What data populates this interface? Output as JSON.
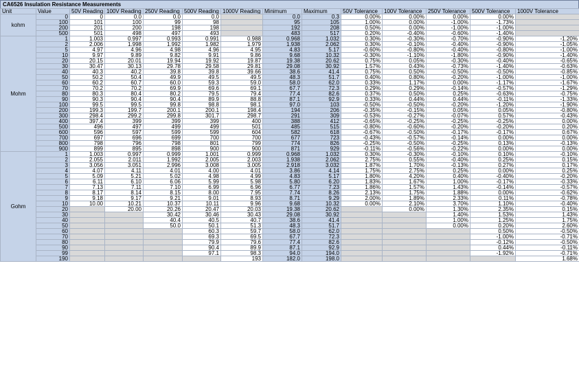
{
  "title": "CA6526 Insulation Resistance Measurements",
  "headers": [
    "Unit",
    "Value",
    "50V Reading",
    "100V Reading",
    "250V Reading",
    "500V Reading",
    "1000V Reading",
    "Minimum",
    "Maximum",
    "50V Tolerance",
    "100V Tolerance",
    "250V Tolerance",
    "500V Tolerance",
    "1000V Tolerance"
  ],
  "groups": [
    {
      "unit": "kohm",
      "rows": [
        [
          "0",
          "0",
          "0.0",
          "0.0",
          "0.0",
          null,
          "0.0",
          "0.3",
          "0.00%",
          "0.00%",
          "0.00%",
          "0.00%",
          null
        ],
        [
          "100",
          "101",
          "100",
          "99",
          "98",
          null,
          "95",
          "105",
          "1.00%",
          "0.00%",
          "-1.00%",
          "-1.73%",
          null
        ],
        [
          "200",
          "201",
          "200",
          "198",
          "198",
          null,
          "192",
          "208",
          "0.50%",
          "0.00%",
          "-1.00%",
          "-1.00%",
          null
        ],
        [
          "500",
          "501",
          "498",
          "497",
          "493",
          null,
          "483",
          "517",
          "0.20%",
          "-0.40%",
          "-0.60%",
          "-1.40%",
          null
        ]
      ]
    },
    {
      "unit": "Mohm",
      "rows": [
        [
          "1",
          "1.003",
          "0.997",
          "0.993",
          "0.991",
          "0.988",
          "0.968",
          "1.032",
          "0.30%",
          "-0.30%",
          "-0.70%",
          "-0.90%",
          "-1.20%"
        ],
        [
          "2",
          "2.006",
          "1.998",
          "1.992",
          "1.982",
          "1.979",
          "1.938",
          "2.062",
          "0.30%",
          "-0.10%",
          "-0.40%",
          "-0.90%",
          "-1.05%"
        ],
        [
          "5",
          "4.97",
          "4.96",
          "4.98",
          "4.96",
          "4.95",
          "4.83",
          "5.17",
          "-0.60%",
          "-0.80%",
          "-0.40%",
          "-0.80%",
          "-1.00%"
        ],
        [
          "10",
          "9.97",
          "9.89",
          "9.82",
          "9.91",
          "9.86",
          "9.68",
          "10.32",
          "-0.30%",
          "-1.10%",
          "-1.80%",
          "-0.90%",
          "-1.40%"
        ],
        [
          "20",
          "20.15",
          "20.01",
          "19.94",
          "19.92",
          "19.87",
          "19.38",
          "20.62",
          "0.75%",
          "0.05%",
          "-0.30%",
          "-0.40%",
          "-0.65%"
        ],
        [
          "30",
          "30.47",
          "30.13",
          "29.78",
          "29.58",
          "29.81",
          "29.08",
          "30.92",
          "1.57%",
          "0.43%",
          "-0.73%",
          "-1.40%",
          "-0.63%"
        ],
        [
          "40",
          "40.3",
          "40.2",
          "39.8",
          "39.8",
          "39.66",
          "38.6",
          "41.4",
          "0.75%",
          "0.50%",
          "-0.50%",
          "-0.50%",
          "-0.85%"
        ],
        [
          "50",
          "50.2",
          "50.4",
          "49.9",
          "49.5",
          "49.5",
          "48.3",
          "51.7",
          "0.40%",
          "0.80%",
          "-0.20%",
          "-1.00%",
          "-1.00%"
        ],
        [
          "60",
          "60.2",
          "60.7",
          "60.0",
          "59.3",
          "59.0",
          "58.0",
          "62.0",
          "0.33%",
          "1.17%",
          "0.00%",
          "-1.17%",
          "-1.67%"
        ],
        [
          "70",
          "70.2",
          "70.2",
          "69.9",
          "69.6",
          "69.1",
          "67.7",
          "72.3",
          "0.29%",
          "0.29%",
          "-0.14%",
          "-0.57%",
          "-1.29%"
        ],
        [
          "80",
          "80.3",
          "80.4",
          "80.2",
          "79.5",
          "79.4",
          "77.4",
          "82.6",
          "0.37%",
          "0.50%",
          "0.25%",
          "-0.63%",
          "-0.75%"
        ],
        [
          "90",
          "90.3",
          "90.4",
          "90.4",
          "89.9",
          "88.8",
          "87.1",
          "92.9",
          "0.33%",
          "0.44%",
          "0.44%",
          "-0.11%",
          "-1.33%"
        ],
        [
          "100",
          "99.5",
          "99.5",
          "99.8",
          "98.8",
          "98.1",
          "97.0",
          "103",
          "-0.50%",
          "-0.50%",
          "-0.20%",
          "-1.20%",
          "-1.90%"
        ],
        [
          "200",
          "199.3",
          "199.7",
          "200.1",
          "200.1",
          "198.4",
          "194",
          "206",
          "-0.35%",
          "-0.15%",
          "0.05%",
          "0.05%",
          "-0.80%"
        ],
        [
          "300",
          "298.4",
          "299.2",
          "299.8",
          "301.7",
          "298.7",
          "291",
          "309",
          "-0.53%",
          "-0.27%",
          "-0.07%",
          "0.57%",
          "-0.43%"
        ],
        [
          "400",
          "397.4",
          "399",
          "399",
          "399",
          "400",
          "388",
          "412",
          "-0.65%",
          "-0.25%",
          "-0.25%",
          "-0.25%",
          "0.00%"
        ],
        [
          "500",
          "496",
          "497",
          "499",
          "499",
          "501",
          "485",
          "515",
          "-0.80%",
          "-0.60%",
          "-0.20%",
          "-0.20%",
          "0.20%"
        ],
        [
          "600",
          "596",
          "597",
          "599",
          "599",
          "604",
          "582",
          "618",
          "-0.67%",
          "-0.50%",
          "-0.17%",
          "-0.17%",
          "0.67%"
        ],
        [
          "700",
          "697",
          "696",
          "699",
          "700",
          "700",
          "677",
          "723",
          "-0.43%",
          "-0.57%",
          "-0.14%",
          "0.00%",
          "0.00%"
        ],
        [
          "800",
          "798",
          "796",
          "798",
          "801",
          "799",
          "774",
          "826",
          "-0.25%",
          "-0.50%",
          "-0.25%",
          "0.13%",
          "-0.13%"
        ],
        [
          "900",
          "899",
          "895",
          "898",
          "900",
          "900",
          "871",
          "929",
          "-0.11%",
          "-0.56%",
          "-0.22%",
          "0.00%",
          "0.00%"
        ]
      ]
    },
    {
      "unit": "Gohm",
      "rows": [
        [
          "1",
          "1.003",
          "0.997",
          "0.999",
          "1.001",
          "0.999",
          "0.968",
          "1.032",
          "0.30%",
          "-0.30%",
          "-0.10%",
          "0.10%",
          "-0.10%"
        ],
        [
          "2",
          "2.055",
          "2.011",
          "1.992",
          "2.005",
          "2.003",
          "1.938",
          "2.062",
          "2.75%",
          "0.55%",
          "-0.40%",
          "0.25%",
          "0.15%"
        ],
        [
          "3",
          "3.056",
          "3.051",
          "2.996",
          "3.008",
          "3.005",
          "2.918",
          "3.032",
          "1.87%",
          "1.70%",
          "-0.13%",
          "0.27%",
          "0.17%"
        ],
        [
          "4",
          "4.07",
          "4.11",
          "4.01",
          "4.00",
          "4.01",
          "3.86",
          "4.14",
          "1.75%",
          "2.75%",
          "0.25%",
          "0.00%",
          "0.25%"
        ],
        [
          "5",
          "5.09",
          "5.21",
          "5.02",
          "4.98",
          "4.99",
          "4.83",
          "5.17",
          "1.80%",
          "4.20%",
          "0.40%",
          "-0.40%",
          "-0.20%"
        ],
        [
          "6",
          "6.11",
          "6.10",
          "6.06",
          "5.99",
          "5.98",
          "5.80",
          "6.20",
          "1.83%",
          "1.67%",
          "1.00%",
          "-0.17%",
          "-0.33%"
        ],
        [
          "7",
          "7.13",
          "7.11",
          "7.10",
          "6.99",
          "6.96",
          "6.77",
          "7.23",
          "1.86%",
          "1.57%",
          "1.43%",
          "-0.14%",
          "-0.57%"
        ],
        [
          "8",
          "8.17",
          "8.14",
          "8.15",
          "8.00",
          "7.95",
          "7.74",
          "8.26",
          "2.13%",
          "1.75%",
          "1.88%",
          "0.00%",
          "-0.62%"
        ],
        [
          "9",
          "9.18",
          "9.17",
          "9.21",
          "9.01",
          "8.93",
          "8.71",
          "9.29",
          "2.00%",
          "1.89%",
          "2.33%",
          "0.11%",
          "-0.78%"
        ],
        [
          "10",
          "10.00",
          "10.21",
          "10.37",
          "10.11",
          "9.96",
          "9.68",
          "10.32",
          "0.00%",
          "2.10%",
          "3.70%",
          "1.10%",
          "-0.40%"
        ],
        [
          "20",
          null,
          "20.00",
          "20.26",
          "20.47",
          "20.03",
          "19.38",
          "20.62",
          null,
          "0.00%",
          "1.30%",
          "2.35%",
          "0.15%"
        ],
        [
          "30",
          null,
          null,
          "30.42",
          "30.46",
          "30.43",
          "29.08",
          "30.92",
          null,
          null,
          "1.40%",
          "1.53%",
          "1.43%"
        ],
        [
          "40",
          null,
          null,
          "40.4",
          "40.5",
          "40.7",
          "38.6",
          "41.4",
          null,
          null,
          "1.00%",
          "1.25%",
          "1.75%"
        ],
        [
          "50",
          null,
          null,
          "50.0",
          "50.1",
          "51.3",
          "48.3",
          "51.7",
          null,
          null,
          "0.00%",
          "0.20%",
          "2.60%"
        ],
        [
          "60",
          null,
          null,
          null,
          "60.3",
          "59.7",
          "58.0",
          "62.0",
          null,
          null,
          null,
          "0.50%",
          "-0.50%"
        ],
        [
          "70",
          null,
          null,
          null,
          "69.3",
          "69.5",
          "67.7",
          "72.3",
          null,
          null,
          null,
          "-1.00%",
          "-0.71%"
        ],
        [
          "80",
          null,
          null,
          null,
          "79.9",
          "79.6",
          "77.4",
          "82.6",
          null,
          null,
          null,
          "-0.12%",
          "-0.50%"
        ],
        [
          "90",
          null,
          null,
          null,
          "90.4",
          "89.9",
          "87.1",
          "92.9",
          null,
          null,
          null,
          "0.44%",
          "-0.11%"
        ],
        [
          "99",
          null,
          null,
          null,
          "97.1",
          "98.3",
          "94.0",
          "194.0",
          null,
          null,
          null,
          "-1.92%",
          "-0.71%"
        ],
        [
          "190",
          null,
          null,
          null,
          null,
          "193",
          "182.0",
          "198.0",
          null,
          null,
          null,
          null,
          "1.68%"
        ]
      ]
    }
  ]
}
